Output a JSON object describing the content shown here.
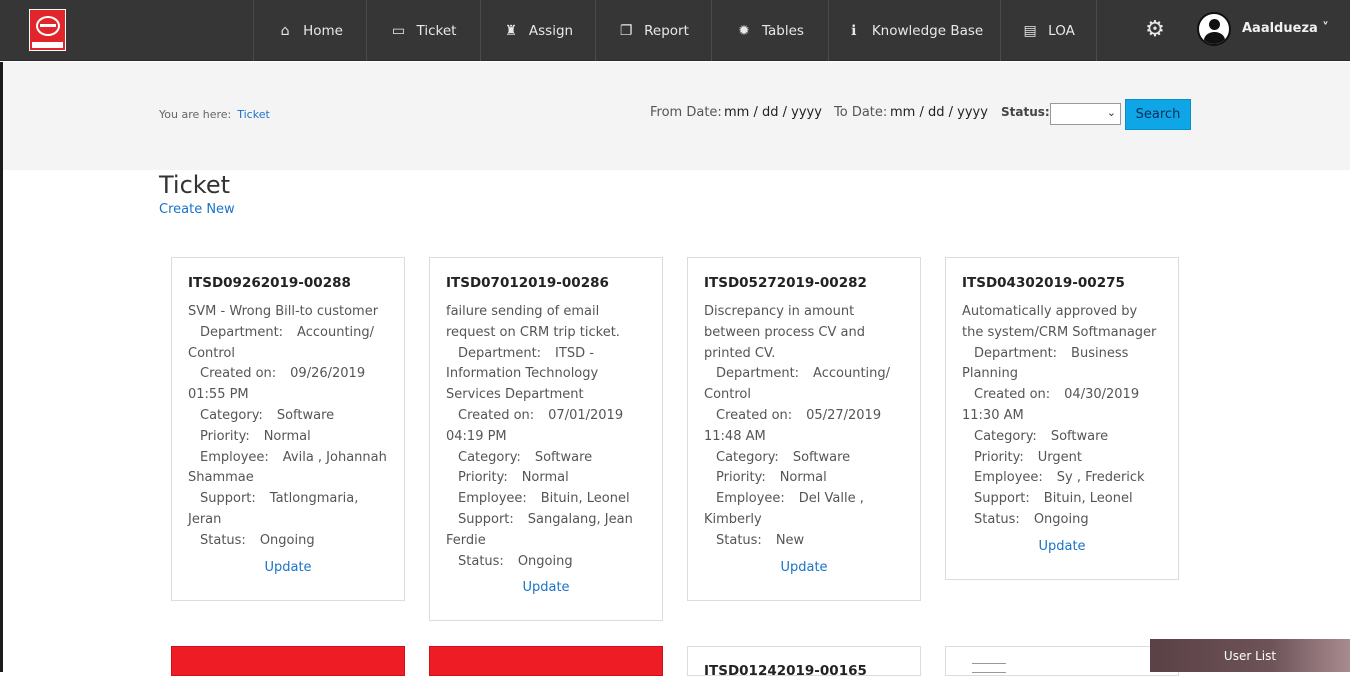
{
  "nav": {
    "items": [
      {
        "label": "Home",
        "icon": "home-icon",
        "glyph": "⌂"
      },
      {
        "label": "Ticket",
        "icon": "ticket-icon",
        "glyph": "▭"
      },
      {
        "label": "Assign",
        "icon": "assign-icon",
        "glyph": "♜"
      },
      {
        "label": "Report",
        "icon": "report-icon",
        "glyph": "❐"
      },
      {
        "label": "Tables",
        "icon": "gear-small-icon",
        "glyph": "✹"
      },
      {
        "label": "Knowledge Base",
        "icon": "info-icon",
        "glyph": "ℹ"
      },
      {
        "label": "LOA",
        "icon": "document-icon",
        "glyph": "▤"
      }
    ],
    "user": "Aaaldueza ˅"
  },
  "breadcrumb": {
    "prefix": "You are here:",
    "current": "Ticket"
  },
  "filters": {
    "from_label": "From Date:",
    "from_value": "mm / dd / yyyy",
    "to_label": "To Date:",
    "to_value": "mm / dd / yyyy",
    "status_label": "Status:",
    "status_value": "",
    "search_label": "Search"
  },
  "page": {
    "title": "Ticket",
    "create_new": "Create New"
  },
  "labels": {
    "department": "Department:",
    "created_on": "Created on:",
    "category": "Category:",
    "priority": "Priority:",
    "employee": "Employee:",
    "support": "Support:",
    "status": "Status:",
    "update": "Update"
  },
  "tickets": [
    {
      "id": "ITSD09262019-00288",
      "subject": "SVM - Wrong Bill-to customer",
      "department": "Accounting/ Control",
      "created_on": "09/26/2019 01:55 PM",
      "category": "Software",
      "priority": "Normal",
      "employee": "Avila , Johannah Shammae",
      "support": "Tatlongmaria, Jeran",
      "status": "Ongoing"
    },
    {
      "id": "ITSD07012019-00286",
      "subject": "failure sending of email request on CRM trip ticket.",
      "department": "ITSD - Information Technology Services Department",
      "created_on": "07/01/2019 04:19 PM",
      "category": "Software",
      "priority": "Normal",
      "employee": "Bituin, Leonel",
      "support": "Sangalang, Jean Ferdie",
      "status": "Ongoing"
    },
    {
      "id": "ITSD05272019-00282",
      "subject": "Discrepancy in amount between process CV and printed CV.",
      "department": "Accounting/ Control",
      "created_on": "05/27/2019 11:48 AM",
      "category": "Software",
      "priority": "Normal",
      "employee": "Del Valle , Kimberly",
      "support": "",
      "status": "New"
    },
    {
      "id": "ITSD04302019-00275",
      "subject": "Automatically approved by the system/CRM Softmanager",
      "department": "Business Planning",
      "created_on": "04/30/2019 11:30 AM",
      "category": "Software",
      "priority": "Urgent",
      "employee": "Sy , Frederick",
      "support": "Bituin, Leonel",
      "status": "Ongoing"
    }
  ],
  "second_row": {
    "partial_id": "ITSD01242019-00165"
  },
  "userlist": {
    "label": "User List"
  },
  "colors": {
    "topbar": "#363636",
    "accent": "#0ea6e6",
    "link": "#1a73c8",
    "brand_red": "#e0262b"
  }
}
